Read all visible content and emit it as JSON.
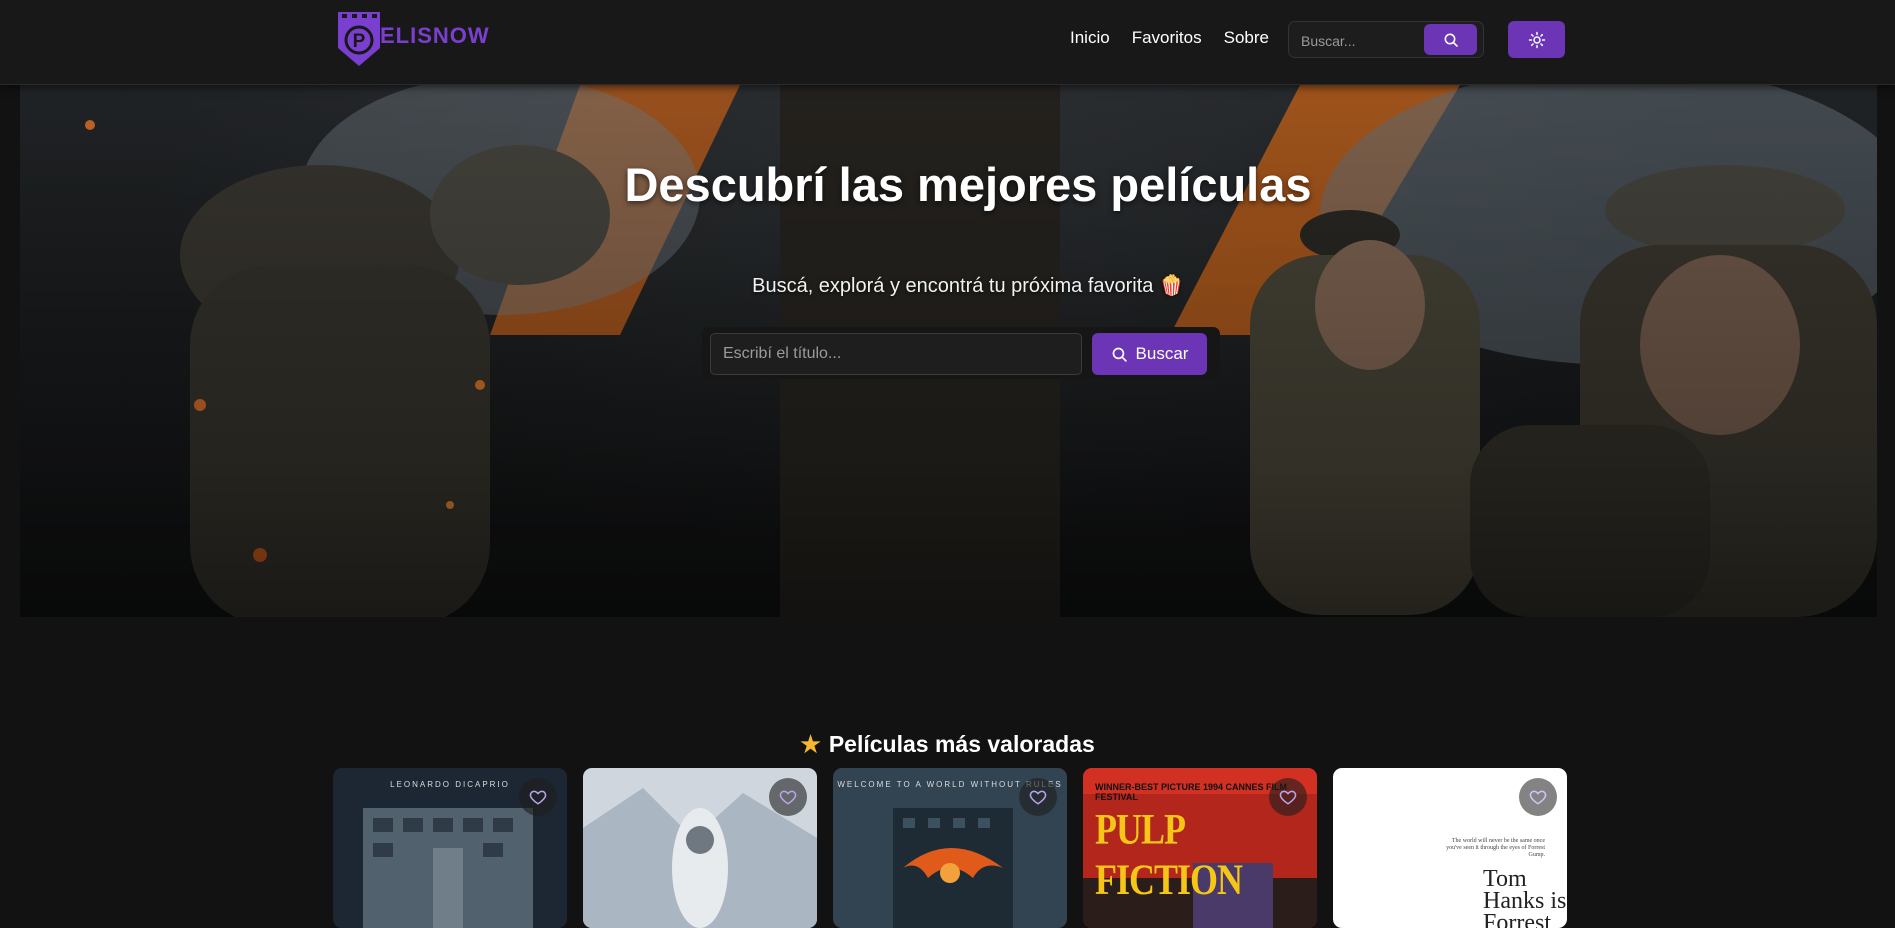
{
  "brand": {
    "name": "ELISNOW",
    "logo_letter": "P"
  },
  "nav": {
    "links": [
      "Inicio",
      "Favoritos",
      "Sobre"
    ],
    "search_placeholder": "Buscar...",
    "search_icon": "search-icon",
    "theme_icon": "sun-icon"
  },
  "hero": {
    "title": "Descubrí las mejores películas",
    "subtitle": "Buscá, explorá y encontrá tu próxima favorita 🍿",
    "input_placeholder": "Escribí el título...",
    "button_label": "Buscar"
  },
  "top_rated": {
    "heading": "Películas más valoradas",
    "heading_icon": "star-icon",
    "movies": [
      {
        "poster_caption": "LEONARDO DICAPRIO",
        "fav_icon": "heart-icon"
      },
      {
        "poster_caption": "",
        "fav_icon": "heart-icon"
      },
      {
        "poster_caption": "WELCOME TO A WORLD WITHOUT RULES",
        "fav_icon": "heart-icon"
      },
      {
        "poster_caption": "PULP FICTION",
        "poster_tag": "WINNER-BEST PICTURE 1994 CANNES FILM FESTIVAL",
        "fav_icon": "heart-icon"
      },
      {
        "poster_caption": "Tom Hanks is Forrest",
        "poster_tag": "The world will never be the same once you've seen it through the eyes of Forrest Gump.",
        "fav_icon": "heart-icon"
      }
    ]
  },
  "colors": {
    "accent": "#6b35b5",
    "background": "#121212",
    "navbar": "#181818",
    "star": "#f5b82e"
  }
}
